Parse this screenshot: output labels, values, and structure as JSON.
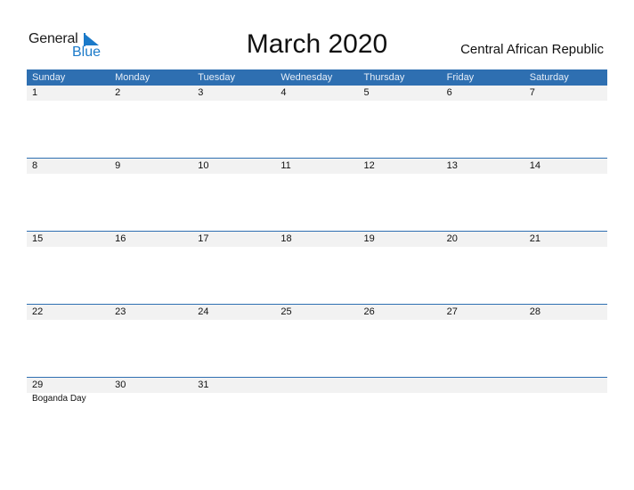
{
  "logo": {
    "word1": "General",
    "word2": "Blue"
  },
  "title": "March 2020",
  "country": "Central African Republic",
  "colors": {
    "header": "#2e6fb1",
    "row_bg": "#f2f2f2",
    "logo_blue": "#1b7ac9"
  },
  "weekdays": [
    "Sunday",
    "Monday",
    "Tuesday",
    "Wednesday",
    "Thursday",
    "Friday",
    "Saturday"
  ],
  "weeks": [
    {
      "days": [
        "1",
        "2",
        "3",
        "4",
        "5",
        "6",
        "7"
      ],
      "events": [
        "",
        "",
        "",
        "",
        "",
        "",
        ""
      ]
    },
    {
      "days": [
        "8",
        "9",
        "10",
        "11",
        "12",
        "13",
        "14"
      ],
      "events": [
        "",
        "",
        "",
        "",
        "",
        "",
        ""
      ]
    },
    {
      "days": [
        "15",
        "16",
        "17",
        "18",
        "19",
        "20",
        "21"
      ],
      "events": [
        "",
        "",
        "",
        "",
        "",
        "",
        ""
      ]
    },
    {
      "days": [
        "22",
        "23",
        "24",
        "25",
        "26",
        "27",
        "28"
      ],
      "events": [
        "",
        "",
        "",
        "",
        "",
        "",
        ""
      ]
    },
    {
      "days": [
        "29",
        "30",
        "31",
        "",
        "",
        "",
        ""
      ],
      "events": [
        "Boganda Day",
        "",
        "",
        "",
        "",
        "",
        ""
      ]
    }
  ]
}
